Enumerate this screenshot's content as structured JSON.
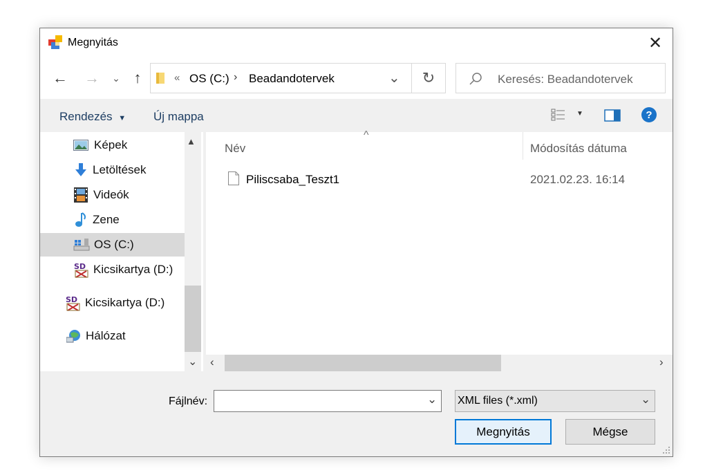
{
  "window": {
    "title": "Megnyitás"
  },
  "address": {
    "sep": "«",
    "path": [
      "OS (C:)",
      "Beadandotervek"
    ]
  },
  "search": {
    "placeholder": "Keresés: Beadandotervek"
  },
  "toolbar": {
    "organize": "Rendezés",
    "new_folder": "Új mappa",
    "help": "?"
  },
  "sidebar": {
    "items": [
      {
        "label": "Képek"
      },
      {
        "label": "Letöltések"
      },
      {
        "label": "Videók"
      },
      {
        "label": "Zene"
      },
      {
        "label": "OS (C:)"
      },
      {
        "label": "Kicsikartya (D:)"
      },
      {
        "label": "Kicsikartya (D:)"
      },
      {
        "label": "Hálózat"
      }
    ]
  },
  "files": {
    "columns": [
      "Név",
      "Módosítás dátuma"
    ],
    "rows": [
      {
        "name": "Piliscsaba_Teszt1",
        "modified": "2021.02.23. 16:14"
      }
    ]
  },
  "footer": {
    "filename_label": "Fájlnév:",
    "filename_value": "",
    "filter": "XML files (*.xml)",
    "open": "Megnyitás",
    "cancel": "Mégse"
  }
}
